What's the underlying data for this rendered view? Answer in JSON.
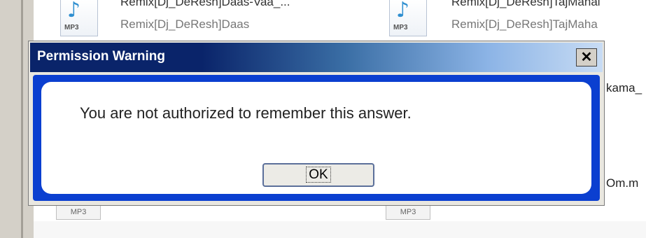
{
  "background": {
    "files": [
      {
        "line1": "Remix[Dj_DeResh]Daas-Vaa_...",
        "line2": "Remix[Dj_DeResh]Daas",
        "type": "MP3"
      },
      {
        "line1": "Remix[Dj_DeResh]TajMahal",
        "line2": "Remix[Dj_DeResh]TajMaha",
        "type": "MP3"
      }
    ],
    "right_cut_1": "kama_",
    "right_cut_2": "Om.m",
    "chip_labels": [
      "MP3",
      "MP3"
    ]
  },
  "dialog": {
    "title": "Permission Warning",
    "close_glyph": "✕",
    "message": "You are not authorized to remember this answer.",
    "ok_label": "OK"
  }
}
